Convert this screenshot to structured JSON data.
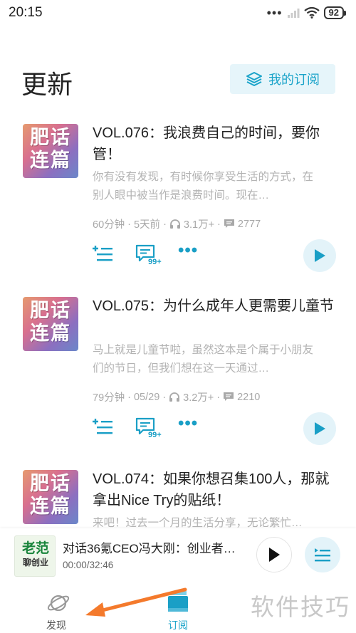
{
  "status_bar": {
    "time": "20:15",
    "dots": "•••",
    "battery": "92"
  },
  "header": {
    "title": "更新",
    "subscriptions_label": "我的订阅"
  },
  "episodes": [
    {
      "cover_text": "肥话连篇",
      "title": "VOL.076：我浪费自己的时间，要你管！",
      "description": "你有没有发现，有时候你享受生活的方式，在别人眼中被当作是浪费时间。现在…",
      "duration": "60分钟",
      "published": "5天前",
      "plays": "3.1万+",
      "comments_count": "2777",
      "comments_badge": "99+"
    },
    {
      "cover_text": "肥话连篇",
      "title": "VOL.075：为什么成年人更需要儿童节",
      "description": "马上就是儿童节啦，虽然这本是个属于小朋友们的节日，但我们想在这一天通过…",
      "duration": "79分钟",
      "published": "05/29",
      "plays": "3.2万+",
      "comments_count": "2210",
      "comments_badge": "99+"
    },
    {
      "cover_text": "肥话连篇",
      "title": "VOL.074：如果你想召集100人，那就拿出Nice Try的贴纸！",
      "description": "来吧！过去一个月的生活分享，无论繁忙…"
    }
  ],
  "mini_player": {
    "cover_line1": "老范",
    "cover_line2": "聊创业",
    "title": "对话36氪CEO冯大刚：创业者…",
    "time": "00:00/32:46"
  },
  "nav": {
    "discover": "发现",
    "subscribe": "订阅"
  },
  "watermark": "软件技巧",
  "colors": {
    "accent": "#19a3c9",
    "accent_light": "#e3f3f9",
    "annotation_arrow": "#f47a2c"
  }
}
